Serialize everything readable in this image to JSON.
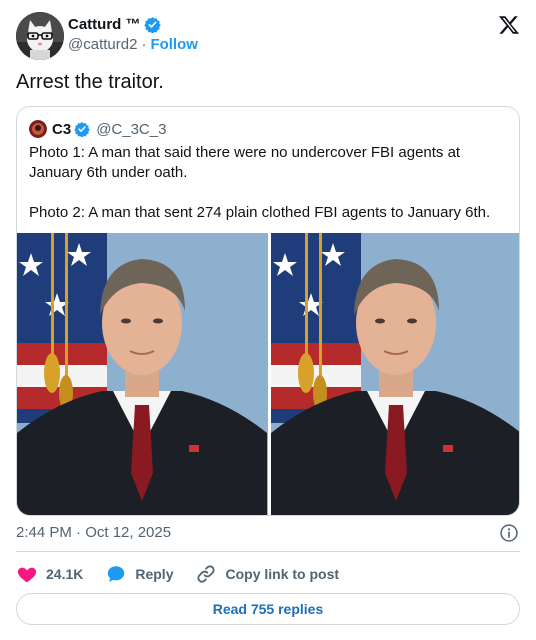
{
  "author": {
    "name": "Catturd ™",
    "handle": "@catturd2",
    "separator": "·",
    "follow_label": "Follow"
  },
  "tweet": {
    "text": "Arrest the traitor."
  },
  "quoted": {
    "name": "C3",
    "handle": "@C_3C_3",
    "paragraphs": [
      "Photo 1: A man that said there were no undercover FBI agents at January 6th under oath.",
      "Photo 2: A man that sent 274 plain clothed FBI agents to January 6th."
    ]
  },
  "meta": {
    "timestamp": "2:44 PM · Oct 12, 2025"
  },
  "actions": {
    "likes": "24.1K",
    "reply_label": "Reply",
    "copy_label": "Copy link to post"
  },
  "replies": {
    "label": "Read 755 replies"
  },
  "colors": {
    "accent": "#1d9bf0",
    "like": "#f91880",
    "text": "#0f1419",
    "muted": "#536471",
    "border": "#cfd9de"
  },
  "icons": {
    "verified": "verified-badge-icon",
    "x_logo": "x-logo-icon",
    "info": "info-icon",
    "heart": "heart-icon",
    "reply": "reply-bubble-icon",
    "link": "link-icon"
  }
}
